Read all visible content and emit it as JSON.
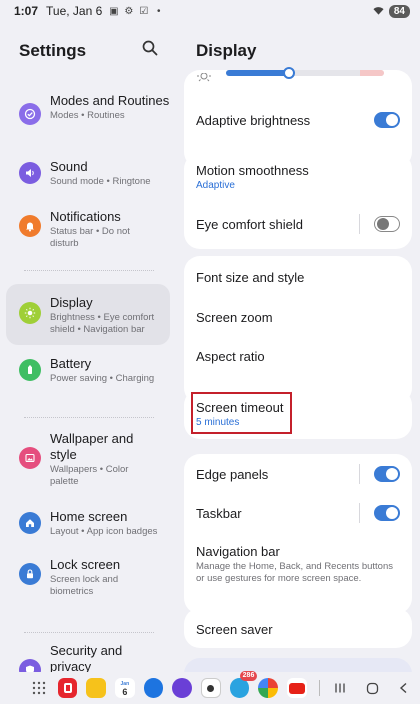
{
  "status_bar": {
    "time": "1:07",
    "date": "Tue, Jan 6",
    "battery": "84",
    "icons": [
      "screenshot-icon",
      "settings-icon",
      "checkbox-icon",
      "dot-icon"
    ]
  },
  "left_panel": {
    "title": "Settings",
    "items": [
      {
        "title": "Modes and Routines",
        "subtitle": "Modes • Routines",
        "icon": "check-circle-icon",
        "color": "#8a6de9"
      },
      {
        "title": "Sound",
        "subtitle": "Sound mode • Ringtone",
        "icon": "speaker-icon",
        "color": "#7b5de0"
      },
      {
        "title": "Notifications",
        "subtitle": "Status bar • Do not disturb",
        "icon": "bell-icon",
        "color": "#f07b2c"
      },
      {
        "title": "Display",
        "subtitle": "Brightness • Eye comfort shield • Navigation bar",
        "icon": "sun-icon",
        "color": "#9fcf37"
      },
      {
        "title": "Battery",
        "subtitle": "Power saving • Charging",
        "icon": "battery-icon",
        "color": "#3fbe63"
      },
      {
        "title": "Wallpaper and style",
        "subtitle": "Wallpapers • Color palette",
        "icon": "image-icon",
        "color": "#e54e7e"
      },
      {
        "title": "Home screen",
        "subtitle": "Layout • App icon badges",
        "icon": "home-icon",
        "color": "#3a7bd5"
      },
      {
        "title": "Lock screen",
        "subtitle": "Screen lock and biometrics",
        "icon": "lock-icon",
        "color": "#3a7bd5"
      },
      {
        "title": "Security and privacy",
        "subtitle": "",
        "icon": "shield-icon",
        "color": "#7b5de0"
      }
    ]
  },
  "right_panel": {
    "title": "Display",
    "brightness_level": 0.4,
    "adaptive_brightness": {
      "label": "Adaptive brightness",
      "on": true
    },
    "motion_smoothness": {
      "label": "Motion smoothness",
      "value": "Adaptive"
    },
    "eye_comfort": {
      "label": "Eye comfort shield",
      "on": false
    },
    "font_size": {
      "label": "Font size and style"
    },
    "screen_zoom": {
      "label": "Screen zoom"
    },
    "aspect_ratio": {
      "label": "Aspect ratio"
    },
    "screen_timeout": {
      "label": "Screen timeout",
      "value": "5 minutes"
    },
    "edge_panels": {
      "label": "Edge panels",
      "on": true
    },
    "taskbar": {
      "label": "Taskbar",
      "on": true
    },
    "navigation_bar": {
      "label": "Navigation bar",
      "description": "Manage the Home, Back, and Recents buttons or use gestures for more screen space."
    },
    "screen_saver": {
      "label": "Screen saver"
    }
  },
  "taskbar": {
    "calendar_month": "Jan",
    "calendar_day": "6",
    "telegram_badge": "286",
    "apps": [
      "apps-grid-icon",
      "red-app-icon",
      "notes-app-icon",
      "calendar-app-icon",
      "chat-app-icon",
      "purple-app-icon",
      "camera-app-icon",
      "telegram-app-icon",
      "photos-app-icon",
      "youtube-app-icon"
    ],
    "nav": [
      "recents-icon",
      "home-icon",
      "back-icon"
    ]
  },
  "colors": {
    "accent": "#3a7bd5",
    "background": "#f0f0f5",
    "highlight": "#c4202b"
  }
}
